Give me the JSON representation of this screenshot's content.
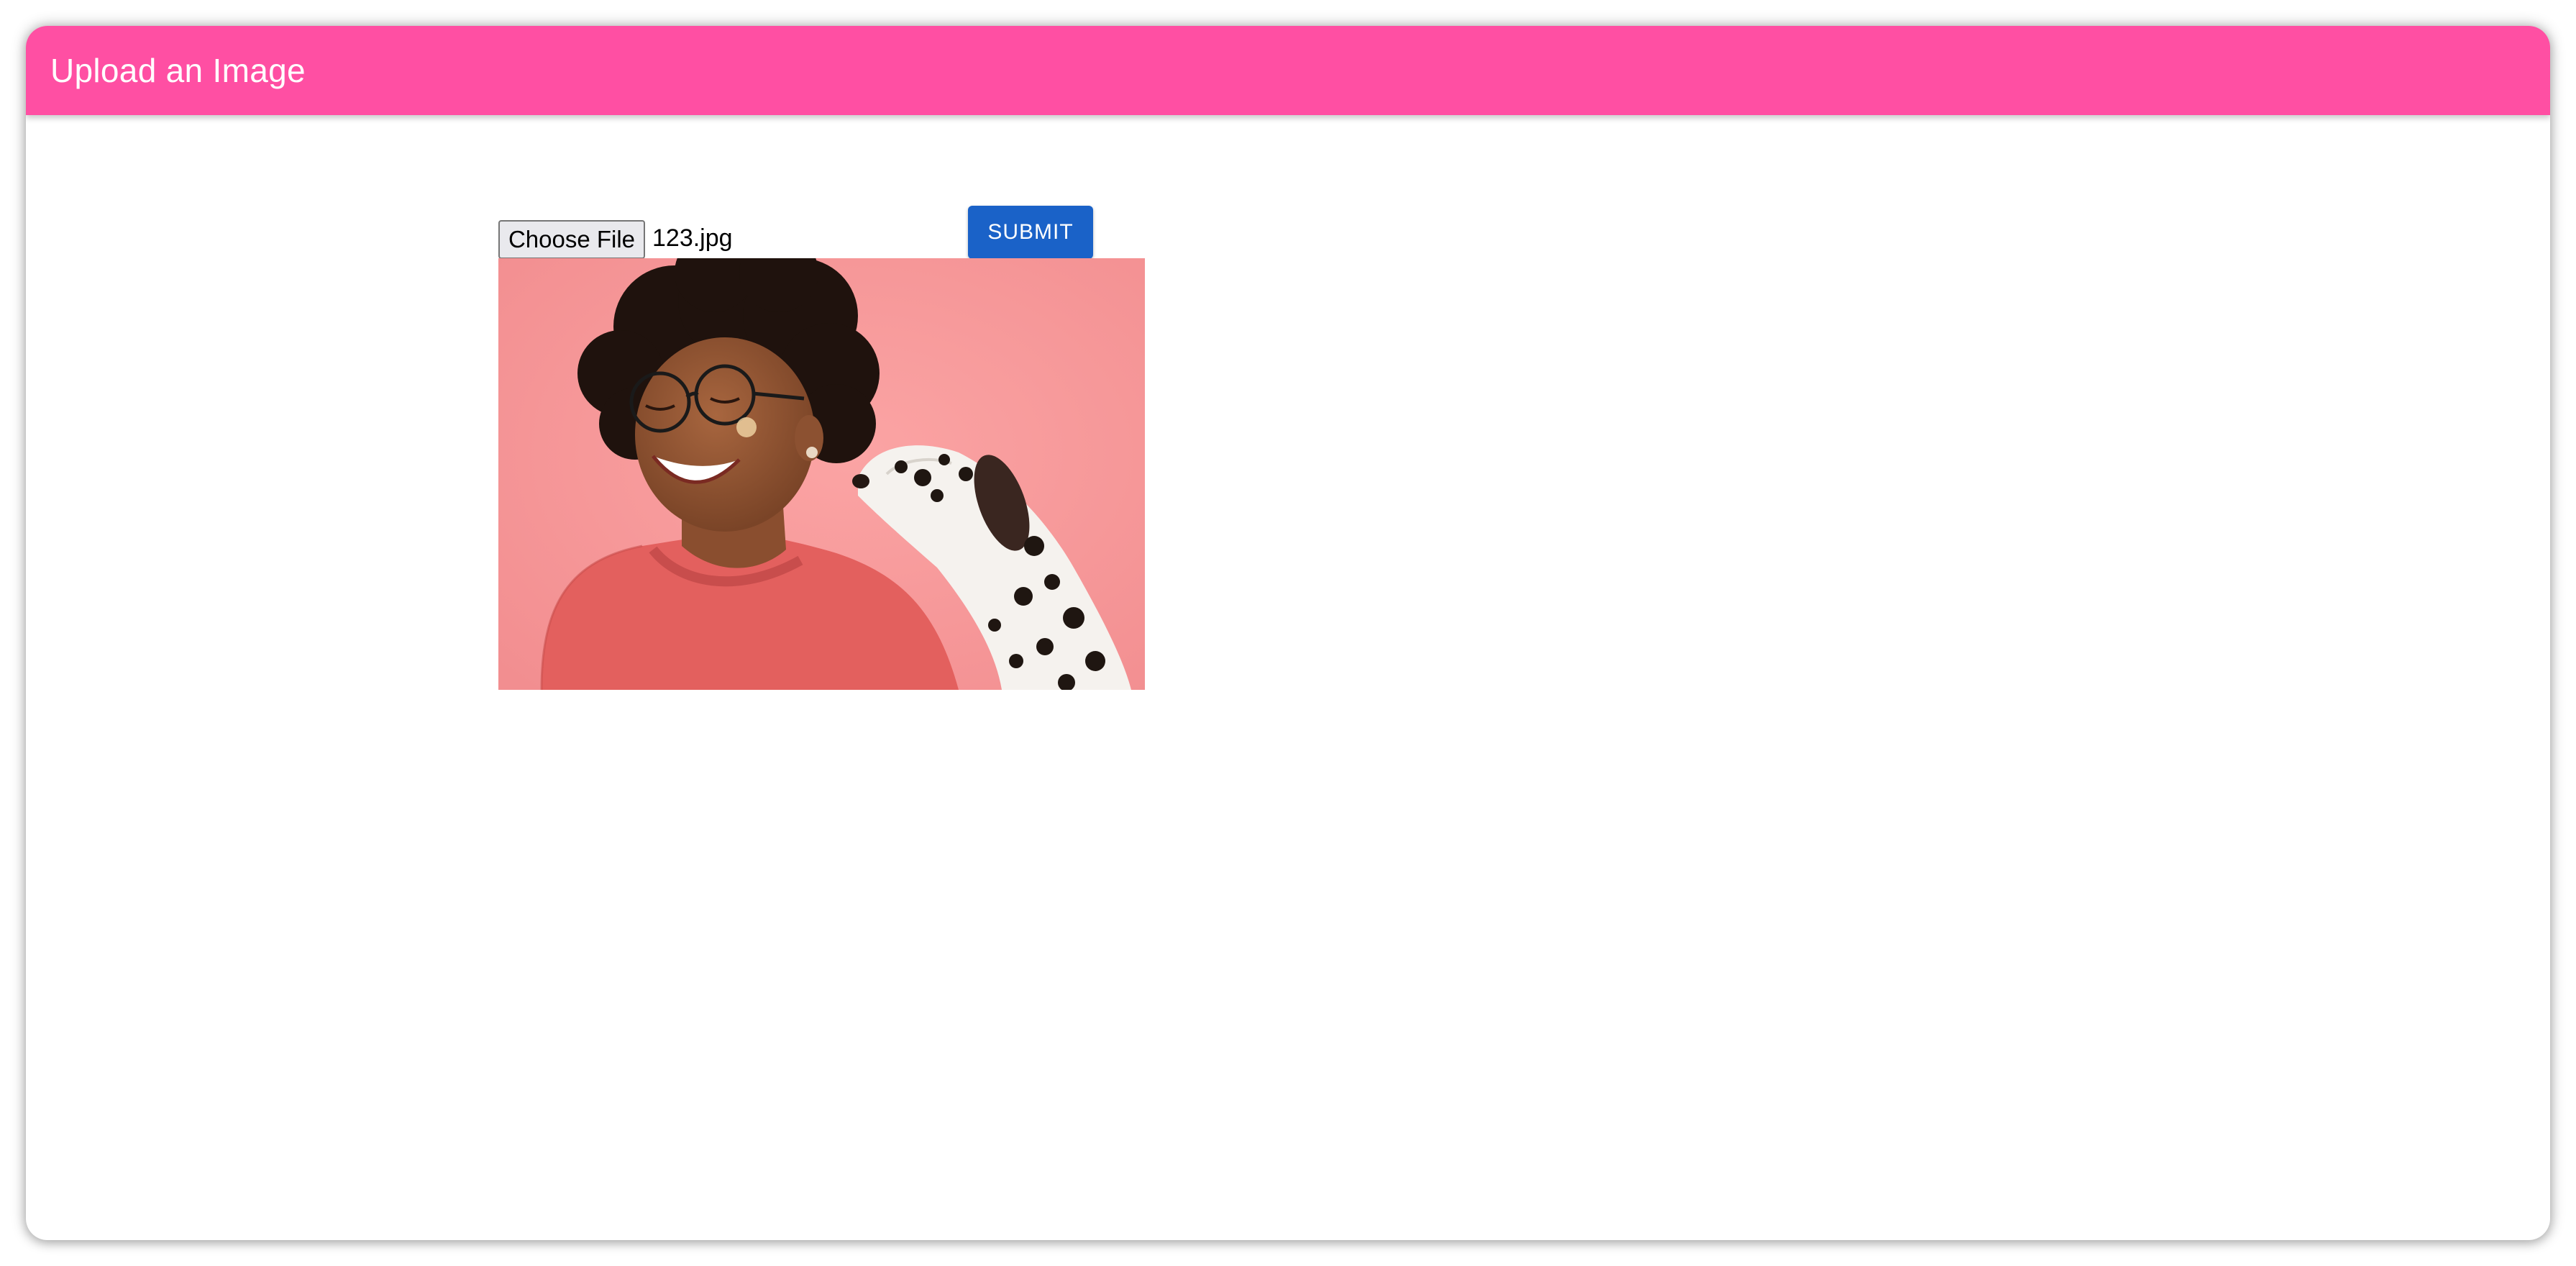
{
  "theme": {
    "appbar_color": "#ff4fa3",
    "accent_color": "#1a62c8",
    "photo_background": "#f89a9a"
  },
  "appbar": {
    "title": "Upload an Image"
  },
  "upload_form": {
    "choose_file_label": "Choose File",
    "selected_file": "123.jpg",
    "submit_label": "SUBMIT"
  },
  "preview": {
    "alt": "Laughing woman with curly hair and glasses in a coral sweater being kissed by a dalmatian"
  }
}
